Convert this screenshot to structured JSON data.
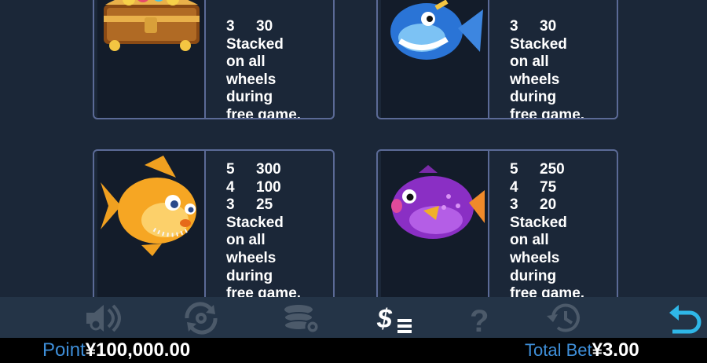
{
  "paytable": {
    "cards": [
      {
        "symbol": "treasure-chest",
        "rows": [
          {
            "count": "3",
            "payout": "30"
          }
        ],
        "lines": [
          "Stacked",
          "on all",
          "wheels",
          "during",
          "free game."
        ]
      },
      {
        "symbol": "blue-fish",
        "rows": [
          {
            "count": "3",
            "payout": "30"
          }
        ],
        "lines": [
          "Stacked",
          "on all",
          "wheels",
          "during",
          "free game."
        ]
      },
      {
        "symbol": "goldfish",
        "rows": [
          {
            "count": "5",
            "payout": "300"
          },
          {
            "count": "4",
            "payout": "100"
          },
          {
            "count": "3",
            "payout": "25"
          }
        ],
        "lines": [
          "Stacked",
          "on all",
          "wheels",
          "during",
          "free game."
        ]
      },
      {
        "symbol": "purple-pufferfish",
        "rows": [
          {
            "count": "5",
            "payout": "250"
          },
          {
            "count": "4",
            "payout": "75"
          },
          {
            "count": "3",
            "payout": "20"
          }
        ],
        "lines": [
          "Stacked",
          "on all",
          "wheels",
          "during",
          "free game."
        ]
      }
    ]
  },
  "toolbar": {
    "icons": [
      "sound-settings-icon",
      "autoplay-icon",
      "bet-chips-icon",
      "paytable-icon",
      "help-icon",
      "history-icon",
      "back-icon"
    ],
    "active": "paytable-icon",
    "colors": {
      "inactive": "#4c5a6a",
      "active": "#ffffff",
      "back": "#2fb7e8"
    }
  },
  "status": {
    "point_label": "Point",
    "point_value": "¥100,000.00",
    "total_bet_label": "Total Bet",
    "total_bet_value": "¥3.00"
  }
}
